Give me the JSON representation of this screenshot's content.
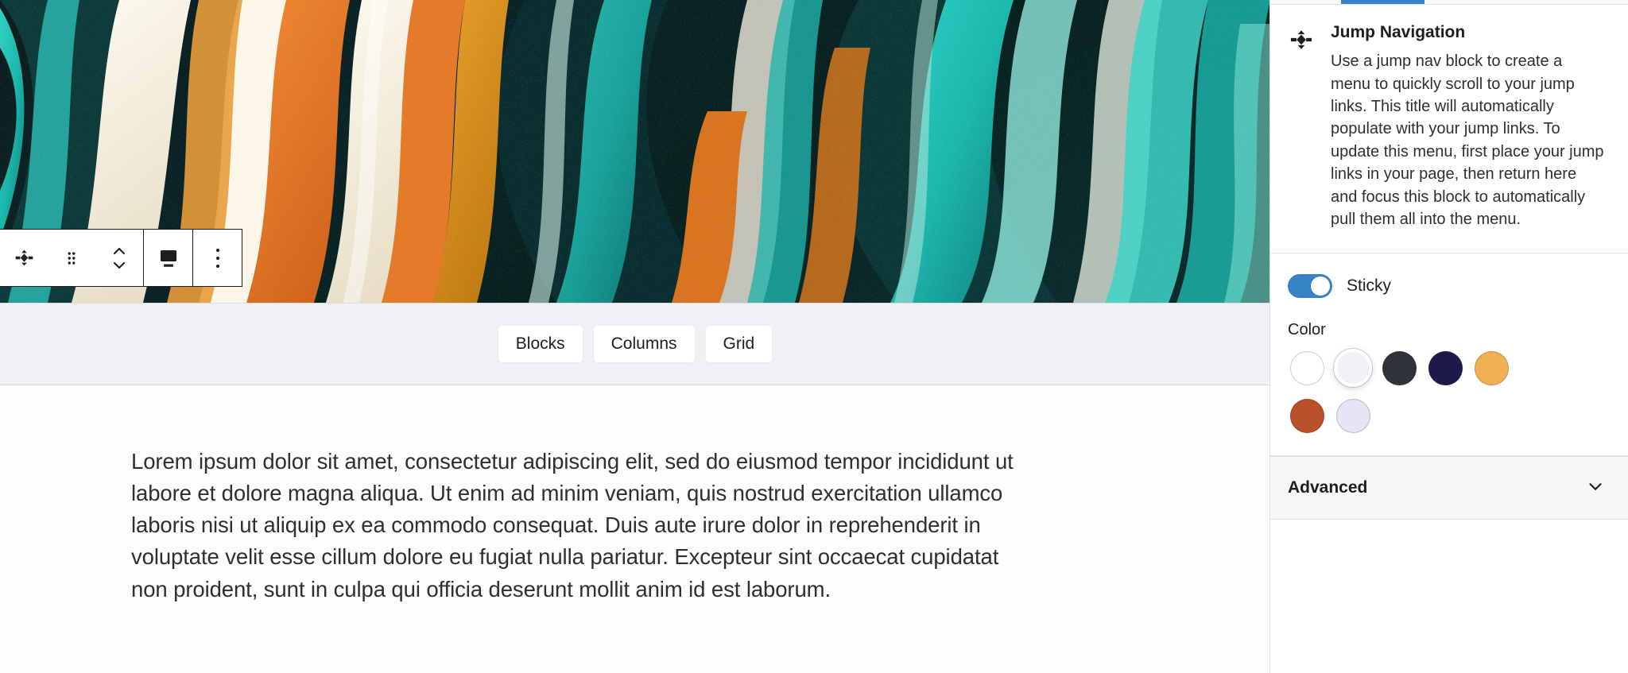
{
  "editor": {
    "cover_block": {
      "name": "cover-image-block",
      "alt": "Abstract marbled fluid art in teal, orange, cream and black"
    },
    "block_toolbar": {
      "buttons": [
        {
          "name": "change-block-type-icon",
          "label": "Jump Navigation block type"
        },
        {
          "name": "drag-handle-icon",
          "label": "Drag"
        },
        {
          "name": "move-up-down-icon",
          "label": "Move up or down"
        },
        {
          "name": "align-icon",
          "label": "Align"
        },
        {
          "name": "more-options-icon",
          "label": "Options"
        }
      ]
    },
    "pattern_strip": {
      "chips": [
        {
          "label": "Blocks",
          "name": "pattern-chip-blocks"
        },
        {
          "label": "Columns",
          "name": "pattern-chip-columns"
        },
        {
          "label": "Grid",
          "name": "pattern-chip-grid"
        }
      ]
    },
    "body": {
      "paragraph": "Lorem ipsum dolor sit amet, consectetur adipiscing elit, sed do eiusmod tempor incididunt ut labore et dolore magna aliqua. Ut enim ad minim veniam, quis nostrud exercitation ullamco laboris nisi ut aliquip ex ea commodo consequat. Duis aute irure dolor in reprehenderit in voluptate velit esse cillum dolore eu fugiat nulla pariatur. Excepteur sint occaecat cupidatat non proident, sunt in culpa qui officia deserunt mollit anim id est laborum."
    }
  },
  "sidebar": {
    "active_tab_color": "#3582c4",
    "block_card": {
      "icon": "jump-navigation-icon",
      "title": "Jump Navigation",
      "description": "Use a jump nav block to create a menu to quickly scroll to your jump links. This title will automatically populate with your jump links. To update this menu, first place your jump links in your page, then return here and focus this block to automatically pull them all into the menu."
    },
    "sticky": {
      "label": "Sticky",
      "enabled": true,
      "accent": "#3582c4"
    },
    "color": {
      "label": "Color",
      "swatches": [
        {
          "name": "swatch-white",
          "hex": "#ffffff",
          "selected": false
        },
        {
          "name": "swatch-off-white",
          "hex": "#f1f1f7",
          "selected": true
        },
        {
          "name": "swatch-charcoal",
          "hex": "#2d3338",
          "selected": false
        },
        {
          "name": "swatch-navy",
          "hex": "#1d1a4a",
          "selected": false
        },
        {
          "name": "swatch-gold",
          "hex": "#f0b053",
          "selected": false
        },
        {
          "name": "swatch-rust",
          "hex": "#b8502a",
          "selected": false
        },
        {
          "name": "swatch-pale-lavender",
          "hex": "#e7e5f5",
          "selected": false
        }
      ]
    },
    "advanced": {
      "title": "Advanced",
      "expanded": false,
      "chevron": "chevron-down-icon"
    }
  }
}
